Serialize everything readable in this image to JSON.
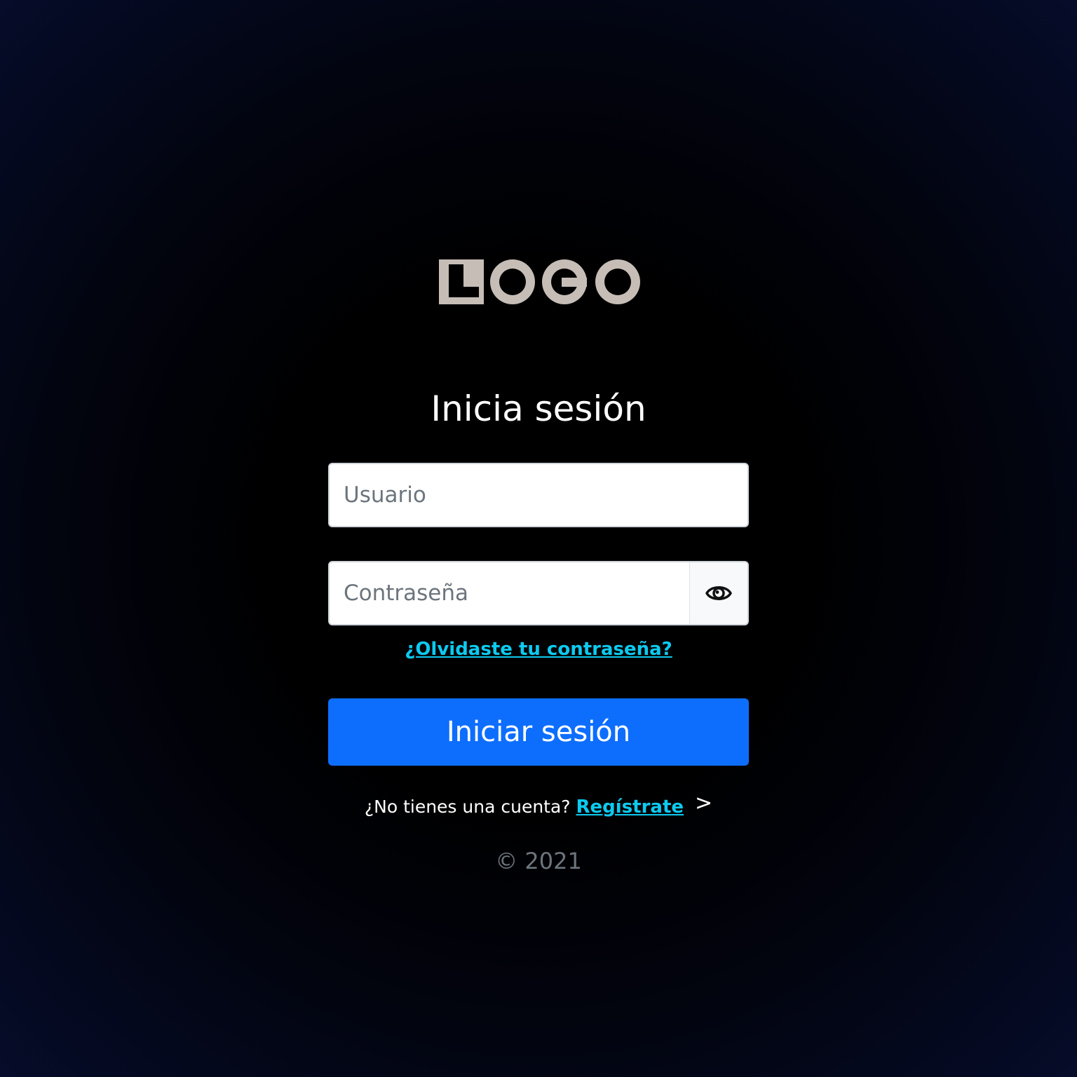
{
  "logo": {
    "text": "LOGO",
    "color": "#c5bdb6"
  },
  "login": {
    "title": "Inicia sesión",
    "username_placeholder": "Usuario",
    "username_value": "",
    "password_placeholder": "Contraseña",
    "password_value": "",
    "show_password_icon": "eye-icon",
    "forgot_password": "¿Olvidaste tu contraseña?",
    "submit_label": "Iniciar sesión"
  },
  "register": {
    "prompt": "¿No tienes una cuenta?",
    "link": "Regístrate",
    "chevron": ">"
  },
  "footer": {
    "copyright": "© 2021"
  },
  "colors": {
    "primary": "#0d6efd",
    "link": "#0dcaf0",
    "muted": "#6c757d",
    "background_edge": "#060c2a"
  }
}
